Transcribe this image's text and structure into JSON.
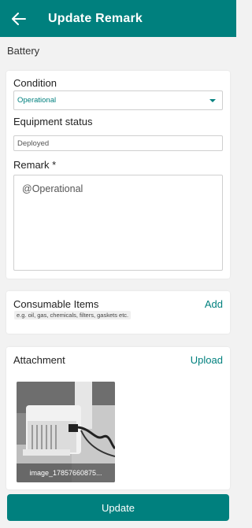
{
  "header": {
    "title": "Update Remark",
    "back_icon": "arrow-left-icon"
  },
  "section_title": "Battery",
  "form": {
    "condition_label": "Condition",
    "condition_value": "Operational",
    "equipment_status_label": "Equipment status",
    "equipment_status_placeholder": "Deployed",
    "remark_label": "Remark *",
    "remark_value": "@Operational"
  },
  "consumables": {
    "title": "Consumable Items",
    "hint": "e.g. oil, gas, chemicals, filters, gaskets etc.",
    "add_label": "Add"
  },
  "attachment": {
    "title": "Attachment",
    "upload_label": "Upload",
    "image_caption": "image_17857660875..."
  },
  "footer": {
    "update_label": "Update"
  },
  "colors": {
    "primary": "#00807e",
    "background": "#f2f2f2"
  }
}
